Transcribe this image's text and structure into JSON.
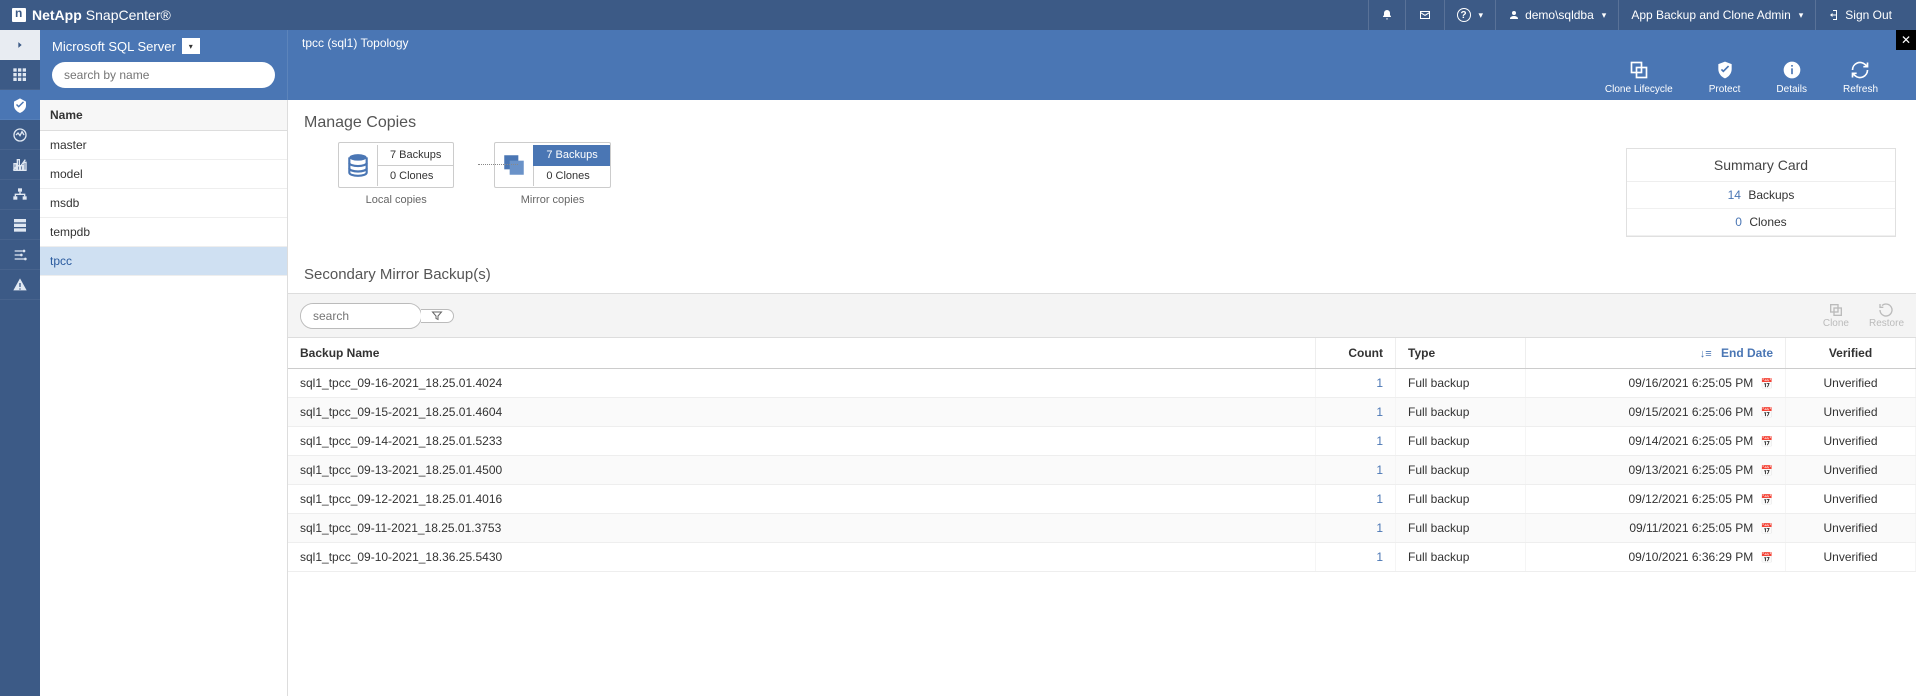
{
  "brand": {
    "company": "NetApp",
    "product": "SnapCenter®"
  },
  "header": {
    "notification_icon": "bell",
    "mail_icon": "mail",
    "help_label": "?",
    "user_label": "demo\\sqldba",
    "role_label": "App Backup and Clone Admin",
    "signout_label": "Sign Out"
  },
  "subheader": {
    "plugin_label": "Microsoft SQL Server",
    "search_placeholder": "search by name",
    "topology_title": "tpcc (sql1) Topology",
    "actions": {
      "clone_lifecycle": "Clone Lifecycle",
      "protect": "Protect",
      "details": "Details",
      "refresh": "Refresh"
    }
  },
  "sidebar": {
    "header": "Name",
    "items": [
      {
        "label": "master"
      },
      {
        "label": "model"
      },
      {
        "label": "msdb"
      },
      {
        "label": "tempdb"
      },
      {
        "label": "tpcc",
        "selected": true
      }
    ]
  },
  "copies": {
    "title": "Manage Copies",
    "local": {
      "backups": "7 Backups",
      "clones": "0 Clones",
      "label": "Local copies"
    },
    "mirror": {
      "backups": "7 Backups",
      "clones": "0 Clones",
      "label": "Mirror copies"
    }
  },
  "summary": {
    "title": "Summary Card",
    "backups_n": "14",
    "backups_l": "Backups",
    "clones_n": "0",
    "clones_l": "Clones"
  },
  "secondary": {
    "title": "Secondary Mirror Backup(s)",
    "search_placeholder": "search",
    "actions": {
      "clone": "Clone",
      "restore": "Restore"
    },
    "columns": {
      "name": "Backup Name",
      "count": "Count",
      "type": "Type",
      "end": "End Date",
      "verified": "Verified"
    },
    "rows": [
      {
        "name": "sql1_tpcc_09-16-2021_18.25.01.4024",
        "count": "1",
        "type": "Full backup",
        "end": "09/16/2021 6:25:05 PM",
        "verified": "Unverified"
      },
      {
        "name": "sql1_tpcc_09-15-2021_18.25.01.4604",
        "count": "1",
        "type": "Full backup",
        "end": "09/15/2021 6:25:06 PM",
        "verified": "Unverified"
      },
      {
        "name": "sql1_tpcc_09-14-2021_18.25.01.5233",
        "count": "1",
        "type": "Full backup",
        "end": "09/14/2021 6:25:05 PM",
        "verified": "Unverified"
      },
      {
        "name": "sql1_tpcc_09-13-2021_18.25.01.4500",
        "count": "1",
        "type": "Full backup",
        "end": "09/13/2021 6:25:05 PM",
        "verified": "Unverified"
      },
      {
        "name": "sql1_tpcc_09-12-2021_18.25.01.4016",
        "count": "1",
        "type": "Full backup",
        "end": "09/12/2021 6:25:05 PM",
        "verified": "Unverified"
      },
      {
        "name": "sql1_tpcc_09-11-2021_18.25.01.3753",
        "count": "1",
        "type": "Full backup",
        "end": "09/11/2021 6:25:05 PM",
        "verified": "Unverified"
      },
      {
        "name": "sql1_tpcc_09-10-2021_18.36.25.5430",
        "count": "1",
        "type": "Full backup",
        "end": "09/10/2021 6:36:29 PM",
        "verified": "Unverified"
      }
    ]
  }
}
